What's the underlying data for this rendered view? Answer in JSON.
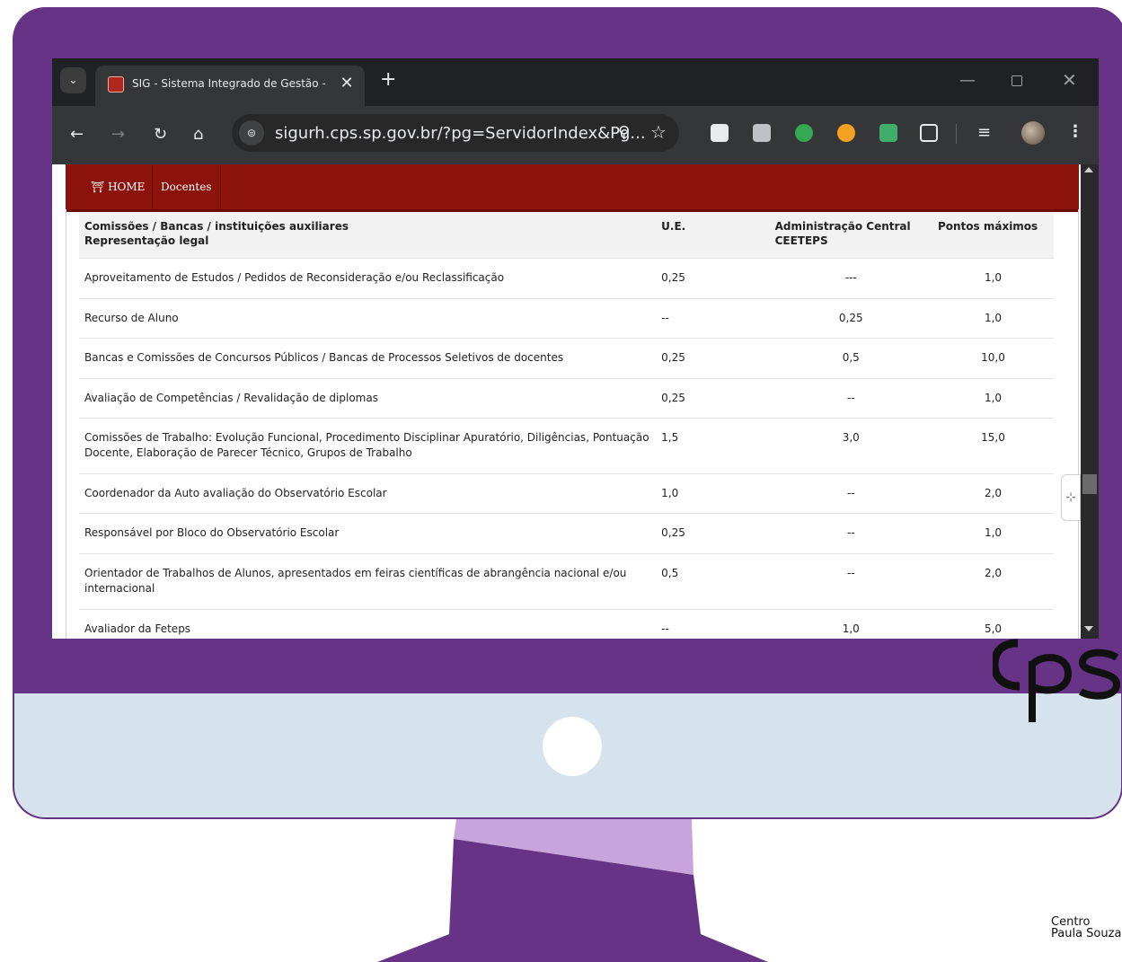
{
  "browser": {
    "tab_title": "SIG - Sistema Integrado de Gestão - URH/",
    "url": "sigurh.cps.sp.gov.br/?pg=ServidorIndex&Pg..."
  },
  "nav": {
    "home_label": "HOME",
    "docentes_label": "Docentes"
  },
  "table": {
    "headers": {
      "col1_line1": "Comissões / Bancas / instituições auxiliares",
      "col1_line2": "Representação legal",
      "col2": "U.E.",
      "col3_line1": "Administração Central",
      "col3_line2": "CEETEPS",
      "col4": "Pontos máximos"
    },
    "rows": [
      {
        "activity": "Aproveitamento de Estudos / Pedidos de Reconsideração e/ou Reclassificação",
        "ue": "0,25",
        "admin": "---",
        "max": "1,0"
      },
      {
        "activity": "Recurso de Aluno",
        "ue": "--",
        "admin": "0,25",
        "max": "1,0"
      },
      {
        "activity": "Bancas e Comissões de Concursos Públicos / Bancas de Processos Seletivos de docentes",
        "ue": "0,25",
        "admin": "0,5",
        "max": "10,0"
      },
      {
        "activity": "Avaliação de Competências / Revalidação de diplomas",
        "ue": "0,25",
        "admin": "--",
        "max": "1,0"
      },
      {
        "activity": "Comissões de Trabalho: Evolução Funcional, Procedimento Disciplinar Apuratório, Diligências, Pontuação Docente, Elaboração de Parecer Técnico, Grupos de Trabalho",
        "ue": "1,5",
        "admin": "3,0",
        "max": "15,0"
      },
      {
        "activity": "Coordenador da Auto avaliação do Observatório Escolar",
        "ue": "1,0",
        "admin": "--",
        "max": "2,0"
      },
      {
        "activity": "Responsável por Bloco do Observatório Escolar",
        "ue": "0,25",
        "admin": "--",
        "max": "1,0"
      },
      {
        "activity": "Orientador de Trabalhos de Alunos, apresentados em feiras científicas de abrangência nacional e/ou internacional",
        "ue": "0,5",
        "admin": "--",
        "max": "2,0"
      },
      {
        "activity": "Avaliador da Feteps",
        "ue": "--",
        "admin": "1,0",
        "max": "5,0"
      }
    ]
  },
  "logo": {
    "line1": "Centro",
    "line2": "Paula Souza"
  },
  "colors": {
    "monitor_frame": "#663387",
    "monitor_chin": "#d7e3ec",
    "stand": "#663387",
    "stand_highlight": "#c9a3dc",
    "navbar": "#8c120c"
  }
}
